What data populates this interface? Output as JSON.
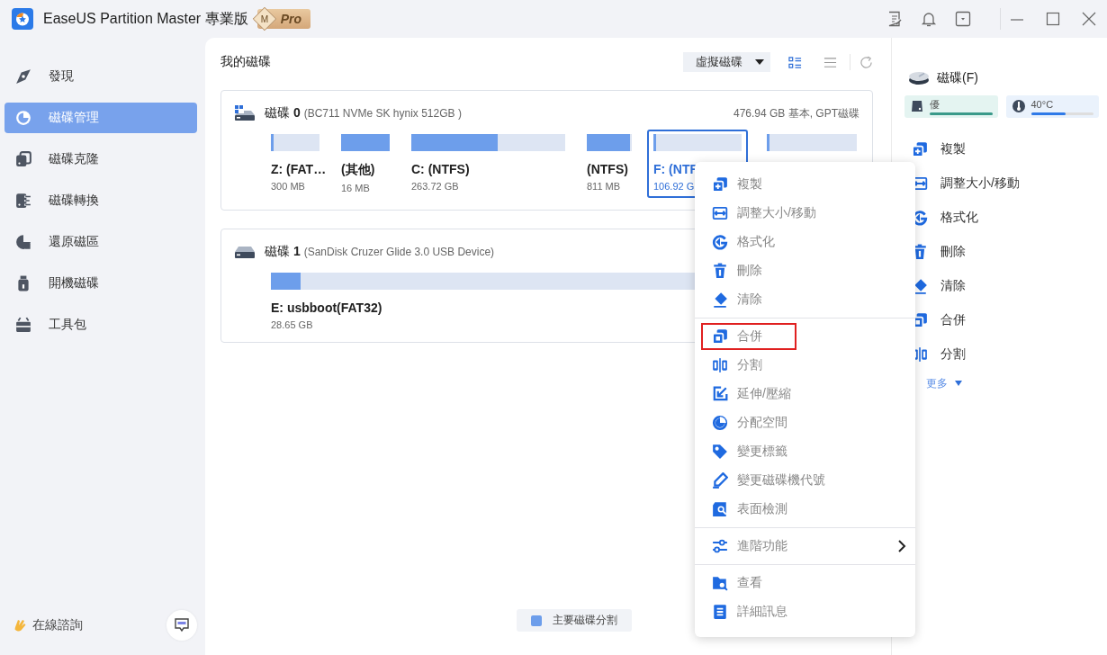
{
  "window": {
    "title": "EaseUS Partition Master 專業版",
    "badge": {
      "letter": "M",
      "text": "Pro"
    }
  },
  "sidebar": {
    "items": [
      {
        "label": "發現",
        "selected": false
      },
      {
        "label": "磁碟管理",
        "selected": true
      },
      {
        "label": "磁碟克隆",
        "selected": false
      },
      {
        "label": "磁碟轉換",
        "selected": false
      },
      {
        "label": "還原磁區",
        "selected": false
      },
      {
        "label": "開機磁碟",
        "selected": false
      },
      {
        "label": "工具包",
        "selected": false
      }
    ],
    "footer": {
      "label": "在線諮詢"
    }
  },
  "main": {
    "title": "我的磁碟",
    "view_dropdown": "虛擬磁碟",
    "view_modes": [
      {
        "kind": "grid",
        "selected": true
      },
      {
        "kind": "list",
        "selected": false
      }
    ],
    "disks": [
      {
        "kind": "system",
        "name": "磁碟 **0**",
        "model": "(BC711 NVMe SK hynix 512GB )",
        "summary": "476.94 GB 基本, GPT磁碟",
        "partitions": [
          {
            "label": "Z: (FAT…",
            "size": "300 MB",
            "level": 0.06,
            "selected": false
          },
          {
            "label": "(其他)",
            "size": "16 MB",
            "level": 1,
            "selected": false
          },
          {
            "label": "C: (NTFS)",
            "size": "263.72 GB",
            "level": 0.56,
            "selected": false
          },
          {
            "label": "(NTFS)",
            "size": "811 MB",
            "level": 0.96,
            "selected": false
          },
          {
            "label": "F: (NTF",
            "size": "106.92 G",
            "level": 0.02,
            "selected": true
          },
          {
            "level": 0.02,
            "selected": false
          }
        ]
      },
      {
        "kind": "removable",
        "name": "磁碟 **1**",
        "model": "(SanDisk Cruzer Glide 3.0 USB Device)",
        "partitions": [
          {
            "label": "E: usbboot(FAT32)",
            "size": "28.65 GB",
            "level": 0.05,
            "selected": false
          }
        ]
      }
    ],
    "legend": [
      {
        "label": "主要磁碟分割",
        "color": "#6d9eeb"
      }
    ]
  },
  "context_menu": {
    "groups": [
      [
        {
          "label": "複製",
          "highlighted": false,
          "submenu": false
        },
        {
          "label": "調整大小/移動",
          "highlighted": false,
          "submenu": false
        },
        {
          "label": "格式化",
          "highlighted": false,
          "submenu": false
        },
        {
          "label": "刪除",
          "highlighted": false,
          "submenu": false
        },
        {
          "label": "清除",
          "highlighted": false,
          "submenu": false
        }
      ],
      [
        {
          "label": "合併",
          "highlighted": true,
          "submenu": false
        },
        {
          "label": "分割",
          "highlighted": false,
          "submenu": false
        },
        {
          "label": "延伸/壓縮",
          "highlighted": false,
          "submenu": false
        },
        {
          "label": "分配空間",
          "highlighted": false,
          "submenu": false
        },
        {
          "label": "變更標籤",
          "highlighted": false,
          "submenu": false
        },
        {
          "label": "變更磁碟機代號",
          "highlighted": false,
          "submenu": false
        },
        {
          "label": "表面檢測",
          "highlighted": false,
          "submenu": false
        }
      ],
      [
        {
          "label": "進階功能",
          "highlighted": false,
          "submenu": true
        }
      ],
      [
        {
          "label": "查看",
          "highlighted": false,
          "submenu": false
        },
        {
          "label": "詳細訊息",
          "highlighted": false,
          "submenu": false
        }
      ]
    ]
  },
  "details": {
    "title": "磁碟(F)",
    "health": [
      {
        "kind": "health",
        "label": "優",
        "level": 1
      },
      {
        "kind": "temperature",
        "label": "40°C",
        "level": 0.56
      }
    ],
    "actions": [
      {
        "label": "複製"
      },
      {
        "label": "調整大小/移動"
      },
      {
        "label": "格式化"
      },
      {
        "label": "刪除"
      },
      {
        "label": "清除"
      },
      {
        "label": "合併"
      },
      {
        "label": "分割"
      }
    ],
    "more": "更多"
  }
}
